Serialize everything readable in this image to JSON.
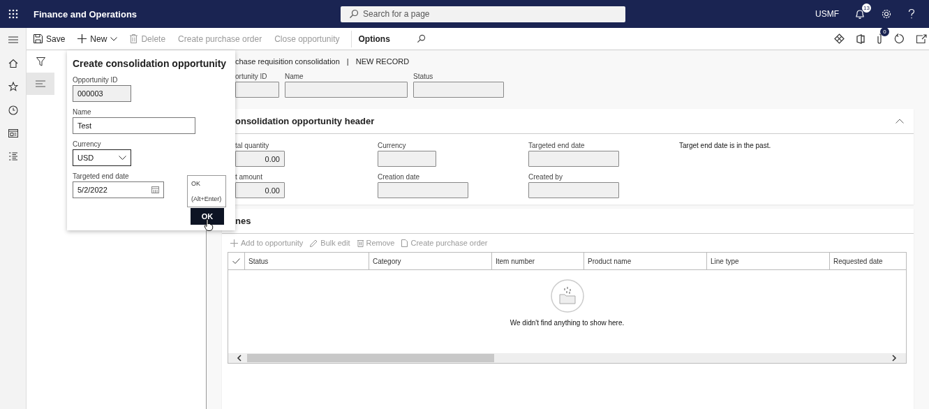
{
  "app": {
    "title": "Finance and Operations",
    "search_placeholder": "Search for a page",
    "company": "USMF",
    "notification_count": "13",
    "attachment_count": "0"
  },
  "command_bar": [
    {
      "label": "Save",
      "kind": "save",
      "disabled": false
    },
    {
      "label": "New",
      "kind": "new",
      "disabled": false
    },
    {
      "label": "Delete",
      "kind": "delete",
      "disabled": true
    },
    {
      "label": "Create purchase order",
      "kind": "plain",
      "disabled": true
    },
    {
      "label": "Close opportunity",
      "kind": "plain",
      "disabled": true
    },
    {
      "label": "Options",
      "kind": "tab",
      "disabled": false
    }
  ],
  "form": {
    "breadcrumb": "chase requisition consolidation",
    "separator": "|",
    "record_state": "NEW RECORD",
    "fields": [
      {
        "label": "ortunity ID"
      },
      {
        "label": "Name"
      },
      {
        "label": "Status"
      }
    ]
  },
  "header": {
    "title": "onsolidation opportunity header",
    "expanded": true,
    "fields": [
      {
        "label": "tal quantity",
        "value": "0.00"
      },
      {
        "label": "Currency"
      },
      {
        "label": "Targeted end date"
      },
      {
        "label": "t amount",
        "value": "0.00"
      },
      {
        "label": "Creation date"
      },
      {
        "label": "Created by"
      }
    ],
    "message": "Target end date is in the past."
  },
  "lines": {
    "title": "nes",
    "actions": [
      {
        "label": "Add to opportunity",
        "kind": "add",
        "disabled": true
      },
      {
        "label": "Bulk edit",
        "kind": "edit",
        "disabled": true
      },
      {
        "label": "Remove",
        "kind": "remove",
        "disabled": true
      },
      {
        "label": "Create purchase order",
        "kind": "document",
        "disabled": true
      }
    ],
    "columns": [
      "Status",
      "Category",
      "Item number",
      "Product name",
      "Line type",
      "Requested date"
    ],
    "empty_message": "We didn't find anything to show here."
  },
  "dialog": {
    "title": "Create consolidation opportunity",
    "fields": [
      {
        "label": "Opportunity ID",
        "value": "000003",
        "kind": "readonly"
      },
      {
        "label": "Name",
        "value": "Test",
        "kind": "text"
      },
      {
        "label": "Currency",
        "value": "USD",
        "kind": "dropdown"
      },
      {
        "label": "Targeted end date",
        "value": "5/2/2022",
        "kind": "date"
      }
    ],
    "ok_button": "OK",
    "tooltip": {
      "title": "OK",
      "shortcut": "(Alt+Enter)"
    }
  }
}
